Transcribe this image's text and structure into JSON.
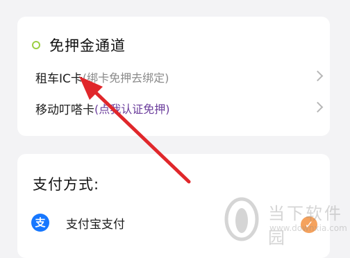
{
  "deposit_free": {
    "title": "免押金通道",
    "rows": [
      {
        "label": "租车IC卡",
        "hint": "(绑卡免押去绑定)"
      },
      {
        "label": "移动叮嗒卡",
        "hint": "(点我认证免押)"
      }
    ]
  },
  "payment": {
    "title": "支付方式:",
    "methods": [
      {
        "icon_glyph": "支",
        "label": "支付宝支付"
      }
    ]
  },
  "watermark": {
    "text": "当下软件园",
    "url": "www.downxia.com"
  },
  "colors": {
    "background": "#f3f3f5",
    "accent_ring": "#9ccf43",
    "hint_purple": "#6b3d9c",
    "alipay_blue": "#1677ff",
    "selected_orange": "#f5a25d",
    "annotation_arrow": "#e0272b"
  },
  "icons": {
    "section_marker": "ring-icon",
    "row_chevron": "chevron-right-icon",
    "alipay": "alipay-icon",
    "selected": "checkmark-icon",
    "watermark_logo": "downxia-logo-icon"
  }
}
